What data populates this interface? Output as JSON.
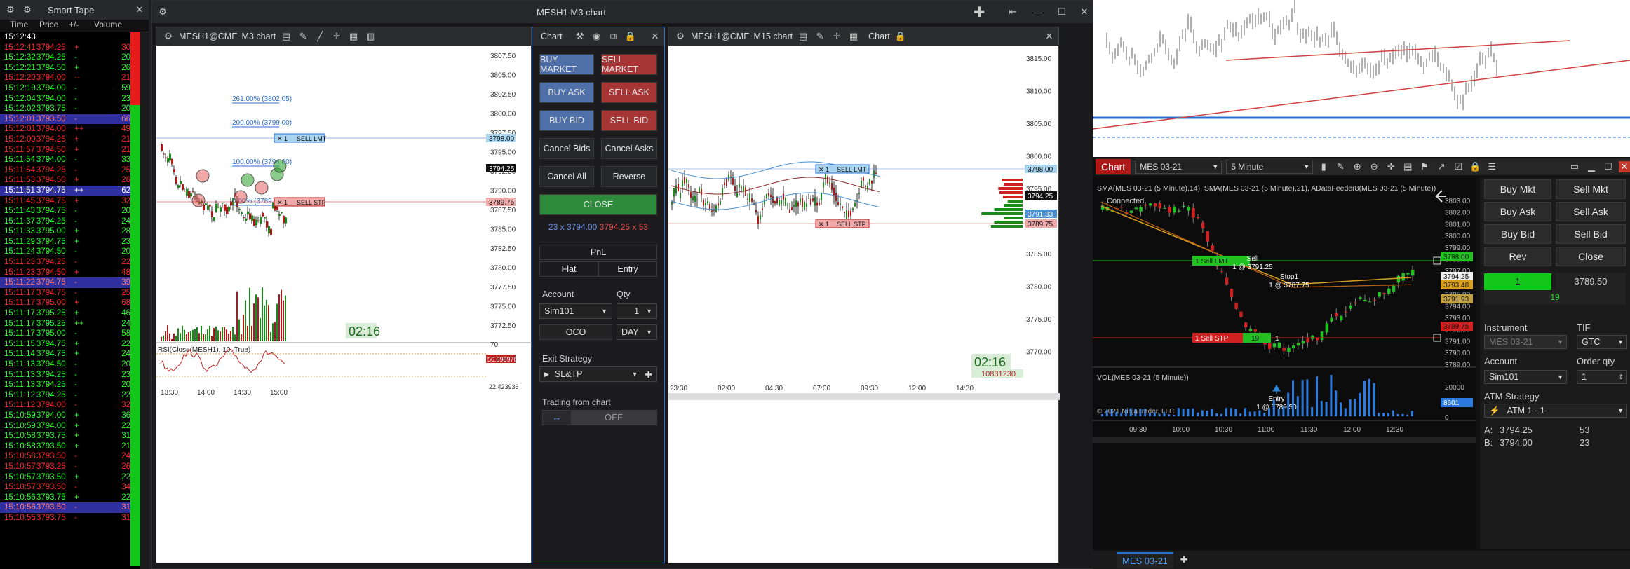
{
  "tape": {
    "title": "Smart Tape",
    "columns": [
      "Time",
      "Price",
      "+/-",
      "Volume"
    ],
    "rows": [
      [
        "15:12:43",
        "",
        "",
        ""
      ],
      [
        "15:12:41",
        "3794.25",
        "+",
        "30"
      ],
      [
        "15:12:32",
        "3794.25",
        "-",
        "20"
      ],
      [
        "15:12:21",
        "3794.50",
        "+",
        "26"
      ],
      [
        "15:12:20",
        "3794.00",
        "--",
        "21"
      ],
      [
        "15:12:19",
        "3794.00",
        "-",
        "59"
      ],
      [
        "15:12:04",
        "3794.00",
        "-",
        "23"
      ],
      [
        "15:12:02",
        "3793.75",
        "-",
        "20"
      ],
      [
        "15:12:01",
        "3793.50",
        "-",
        "66"
      ],
      [
        "15:12:01",
        "3794.00",
        "++",
        "49"
      ],
      [
        "15:12:00",
        "3794.25",
        "+",
        "21"
      ],
      [
        "15:11:57",
        "3794.50",
        "+",
        "21"
      ],
      [
        "15:11:54",
        "3794.00",
        "-",
        "33"
      ],
      [
        "15:11:54",
        "3794.25",
        "-",
        "25"
      ],
      [
        "15:11:53",
        "3794.50",
        "+",
        "26"
      ],
      [
        "15:11:51",
        "3794.75",
        "++",
        "62"
      ],
      [
        "15:11:45",
        "3794.75",
        "+",
        "32"
      ],
      [
        "15:11:43",
        "3794.75",
        "-",
        "20"
      ],
      [
        "15:11:37",
        "3794.25",
        "-",
        "24"
      ],
      [
        "15:11:33",
        "3795.00",
        "+",
        "28"
      ],
      [
        "15:11:29",
        "3794.75",
        "+",
        "23"
      ],
      [
        "15:11:24",
        "3794.50",
        "-",
        "20"
      ],
      [
        "15:11:23",
        "3794.25",
        "-",
        "22"
      ],
      [
        "15:11:23",
        "3794.50",
        "+",
        "48"
      ],
      [
        "15:11:22",
        "3794.75",
        "-",
        "39"
      ],
      [
        "15:11:17",
        "3794.75",
        "-",
        "25"
      ],
      [
        "15:11:17",
        "3795.00",
        "+",
        "68"
      ],
      [
        "15:11:17",
        "3795.25",
        "+",
        "46"
      ],
      [
        "15:11:17",
        "3795.25",
        "++",
        "24"
      ],
      [
        "15:11:17",
        "3795.00",
        "-",
        "58"
      ],
      [
        "15:11:15",
        "3794.75",
        "+",
        "22"
      ],
      [
        "15:11:14",
        "3794.75",
        "+",
        "24"
      ],
      [
        "15:11:13",
        "3794.50",
        "-",
        "20"
      ],
      [
        "15:11:13",
        "3794.25",
        "-",
        "23"
      ],
      [
        "15:11:13",
        "3794.25",
        "-",
        "20"
      ],
      [
        "15:11:12",
        "3794.25",
        "-",
        "22"
      ],
      [
        "15:11:12",
        "3794.00",
        "-",
        "32"
      ],
      [
        "15:10:59",
        "3794.00",
        "+",
        "36"
      ],
      [
        "15:10:59",
        "3794.00",
        "+",
        "22"
      ],
      [
        "15:10:58",
        "3793.75",
        "+",
        "31"
      ],
      [
        "15:10:58",
        "3793.50",
        "+",
        "21"
      ],
      [
        "15:10:58",
        "3793.50",
        "-",
        "24"
      ],
      [
        "15:10:57",
        "3793.25",
        "-",
        "26"
      ],
      [
        "15:10:57",
        "3793.50",
        "+",
        "22"
      ],
      [
        "15:10:57",
        "3793.50",
        "-",
        "34"
      ],
      [
        "15:10:56",
        "3793.75",
        "+",
        "22"
      ],
      [
        "15:10:56",
        "3793.50",
        "-",
        "31"
      ],
      [
        "15:10:55",
        "3793.75",
        "-",
        "31"
      ]
    ],
    "row_colors": [
      "#ffffff",
      "#ff2a2a",
      "#2aff2a",
      "#2aff2a",
      "#ff2a2a",
      "#2aff2a",
      "#2aff2a",
      "#2aff2a",
      "#ff7a7a",
      "#ff2a2a",
      "#ff2a2a",
      "#ff2a2a",
      "#2aff2a",
      "#ff2a2a",
      "#ff2a2a",
      "#ffffff",
      "#ff2a2a",
      "#2aff2a",
      "#2aff2a",
      "#2aff2a",
      "#2aff2a",
      "#2aff2a",
      "#ff2a2a",
      "#ff2a2a",
      "#ff7a7a",
      "#ff2a2a",
      "#ff2a2a",
      "#2aff2a",
      "#2aff2a",
      "#2aff2a",
      "#2aff2a",
      "#2aff2a",
      "#2aff2a",
      "#2aff2a",
      "#2aff2a",
      "#2aff2a",
      "#ff2a2a",
      "#2aff2a",
      "#2aff2a",
      "#2aff2a",
      "#2aff2a",
      "#ff2a2a",
      "#ff2a2a",
      "#2aff2a",
      "#ff2a2a",
      "#2aff2a",
      "#ff7a7a",
      "#ff2a2a"
    ],
    "row_bgs": [
      "",
      "",
      "",
      "",
      "",
      "",
      "",
      "",
      "#2f2fa0",
      "",
      "",
      "",
      "",
      "",
      "",
      "#2f2fa0",
      "",
      "",
      "",
      "",
      "",
      "",
      "",
      "",
      "#2f2fa0",
      "",
      "",
      "",
      "",
      "",
      "",
      "",
      "",
      "",
      "",
      "",
      "",
      "",
      "",
      "",
      "",
      "",
      "",
      "",
      "",
      "",
      "#2f2fa0",
      ""
    ]
  },
  "m3_window": {
    "title": "MESH1 M3 chart",
    "tab_instrument": "MESH1@CME",
    "tab_chart": "M3 chart",
    "panel_label": "Chart",
    "price_axis": [
      "3807.50",
      "3805.00",
      "3802.50",
      "3800.00",
      "3797.50",
      "3795.00",
      "3792.50",
      "3790.00",
      "3787.50",
      "3785.00",
      "3782.50",
      "3780.00",
      "3777.50",
      "3775.00",
      "3772.50"
    ],
    "last_price": "3794.25",
    "sell_limit_price": "3798.00",
    "sell_stop_price": "3789.75",
    "fib_levels": [
      "261.00% (3802.05)",
      "200.00% (3799.00)",
      "100.00% (3794.00)",
      "0.00% (3789.00)"
    ],
    "sell_limit_label": "SELL LMT",
    "sell_stop_label": "SELL STP",
    "qty": "1",
    "clock": "02:16",
    "rsi_label": "RSI(Close(MESH1), 10, True)",
    "rsi_axis": [
      "70",
      "30"
    ],
    "rsi_value": "56.698970",
    "rsi_low": "22.423936",
    "time_axis": [
      "13:30",
      "14:00",
      "14:30",
      "15:00"
    ]
  },
  "order_panel": {
    "buy_market": "BUY MARKET",
    "sell_market": "SELL MARKET",
    "buy_ask": "BUY ASK",
    "sell_ask": "SELL ASK",
    "buy_bid": "BUY BID",
    "sell_bid": "SELL BID",
    "cancel_bids": "Cancel Bids",
    "cancel_asks": "Cancel Asks",
    "cancel_all": "Cancel All",
    "reverse": "Reverse",
    "close": "CLOSE",
    "bid_qty": "23 x 3794.00",
    "ask_qty": "3794.25 x 53",
    "pnl": "PnL",
    "flat": "Flat",
    "entry": "Entry",
    "account_label": "Account",
    "qty_label": "Qty",
    "account": "Sim101",
    "qty": "1",
    "oco": "OCO",
    "tif": "DAY",
    "exit_strategy_label": "Exit Strategy",
    "exit_strategy": "SL&TP",
    "trading_from_chart": "Trading from chart",
    "toggle_state": "OFF"
  },
  "m15_window": {
    "tab_instrument": "MESH1@CME",
    "tab_chart": "M15 chart",
    "panel_label": "Chart",
    "price_axis": [
      "3815.00",
      "3810.00",
      "3805.00",
      "3800.00",
      "3795.00",
      "3790.00",
      "3785.00",
      "3780.00",
      "3775.00",
      "3770.00"
    ],
    "sell_limit_price": "3798.00",
    "last_price": "3794.25",
    "blue_price": "3791.33",
    "sell_stop_price": "3789.75",
    "sell_limit_label": "SELL LMT",
    "sell_stop_label": "SELL STP",
    "qty": "1",
    "clock": "02:16",
    "volume": "10831230",
    "time_axis": [
      "23:30",
      "02:00",
      "04:30",
      "07:00",
      "09:30",
      "12:00",
      "14:30"
    ]
  },
  "nt_window": {
    "chart_label": "Chart",
    "instrument": "MES 03-21",
    "interval": "5 Minute",
    "indicator_label": "SMA(MES 03-21 (5 Minute),14), SMA(MES 03-21 (5 Minute),21), ADataFeeder8(MES 03-21 (5 Minute))",
    "connected": "Connected",
    "price_axis": [
      "3803.00",
      "3802.00",
      "3801.00",
      "3800.00",
      "3799.00",
      "3798.00",
      "3797.00",
      "3796.00",
      "3795.00",
      "3794.00",
      "3793.00",
      "3792.00",
      "3791.00",
      "3790.00",
      "3789.00"
    ],
    "sell_limit": "1  Sell LMT",
    "sell_stop": "1  Sell STP",
    "sell_stop_qty": "19",
    "sell_stop_pos": "1",
    "sell_text": "Sell",
    "sell_price": "1 @ 3791.25",
    "stop_text": "Stop1",
    "stop_price": "1 @ 3787.75",
    "entry_text": "Entry",
    "entry_price": "1 @ 3789.50",
    "labels": [
      "3798.00",
      "3794.25",
      "3793.48",
      "3791.93",
      "3789.75"
    ],
    "vol_label": "VOL(MES 03-21 (5 Minute))",
    "vol_axis": [
      "20000",
      "10000",
      "0"
    ],
    "vol_value": "8601",
    "copyright": "© 2021 NinjaTrader, LLC",
    "time_axis": [
      "09:30",
      "10:00",
      "10:30",
      "11:00",
      "11:30",
      "12:00",
      "12:30"
    ],
    "tab": "MES 03-21",
    "buy_mkt": "Buy Mkt",
    "sell_mkt": "Sell Mkt",
    "buy_ask": "Buy Ask",
    "sell_ask": "Sell Ask",
    "buy_bid": "Buy Bid",
    "sell_bid": "Sell Bid",
    "rev": "Rev",
    "close": "Close",
    "position_qty": "1",
    "position_price": "3789.50",
    "position_pnl": "19",
    "instrument_label": "Instrument",
    "tif_label": "TIF",
    "tif": "GTC",
    "account_label": "Account",
    "order_qty_label": "Order qty",
    "account": "Sim101",
    "order_qty": "1",
    "atm_label": "ATM Strategy",
    "atm": "ATM 1 - 1",
    "ask_label": "A:",
    "ask_price": "3794.25",
    "ask_size": "53",
    "bid_label": "B:",
    "bid_price": "3794.00",
    "bid_size": "23"
  },
  "colors": {
    "buy": "#4f6fa8",
    "sell": "#b03a3a",
    "close": "#2e8b3c",
    "up": "#2aa02a",
    "down": "#c82020"
  }
}
